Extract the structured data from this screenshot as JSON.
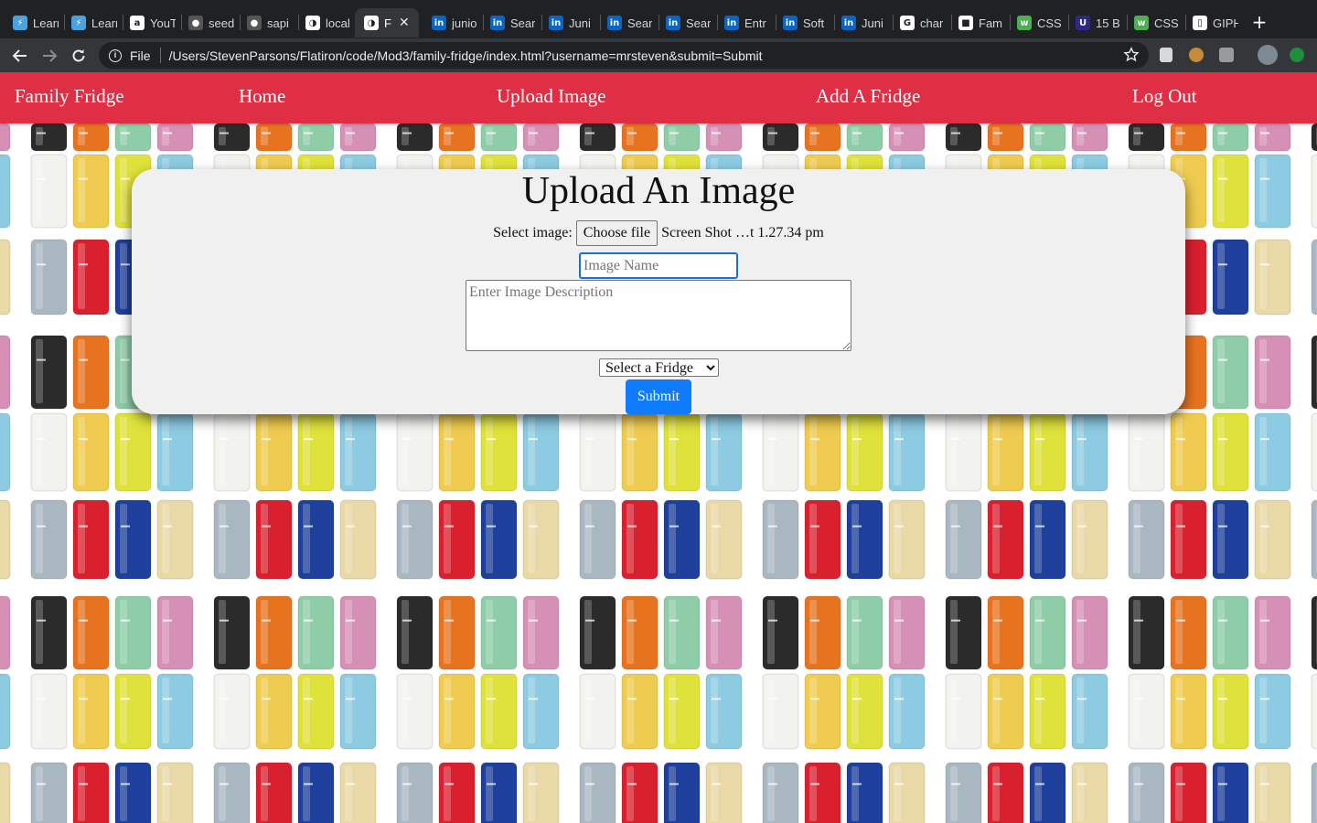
{
  "browser": {
    "tabs": [
      {
        "title": "Learn",
        "icon": "learn-icon",
        "color": "#4aa3df"
      },
      {
        "title": "Learn",
        "icon": "learn-icon",
        "color": "#4aa3df"
      },
      {
        "title": "YouTube",
        "icon": "amazon-icon",
        "color": "#ffffff"
      },
      {
        "title": "seed",
        "icon": "github-icon",
        "color": "#555555"
      },
      {
        "title": "sapi",
        "icon": "github-icon",
        "color": "#555555"
      },
      {
        "title": "local",
        "icon": "globe-icon",
        "color": "#ffffff"
      },
      {
        "title": "F",
        "icon": "globe-icon",
        "color": "#ffffff",
        "active": true
      },
      {
        "title": "junio",
        "icon": "linkedin-icon",
        "color": "#0a66c2"
      },
      {
        "title": "Sear",
        "icon": "linkedin-icon",
        "color": "#0a66c2"
      },
      {
        "title": "Juni",
        "icon": "linkedin-icon",
        "color": "#0a66c2"
      },
      {
        "title": "Sear",
        "icon": "linkedin-icon",
        "color": "#0a66c2"
      },
      {
        "title": "Sear",
        "icon": "linkedin-icon",
        "color": "#0a66c2"
      },
      {
        "title": "Entr",
        "icon": "linkedin-icon",
        "color": "#0a66c2"
      },
      {
        "title": "Soft",
        "icon": "linkedin-icon",
        "color": "#0a66c2"
      },
      {
        "title": "Juni",
        "icon": "linkedin-icon",
        "color": "#0a66c2"
      },
      {
        "title": "char",
        "icon": "google-icon",
        "color": "#ffffff"
      },
      {
        "title": "Fam",
        "icon": "trello-icon",
        "color": "#ffffff"
      },
      {
        "title": "CSS",
        "icon": "w3schools-icon",
        "color": "#4caf50"
      },
      {
        "title": "15 B",
        "icon": "udemy-icon",
        "color": "#2a2a8a"
      },
      {
        "title": "CSS",
        "icon": "w3schools-icon",
        "color": "#4caf50"
      },
      {
        "title": "GIPH",
        "icon": "file-icon",
        "color": "#ffffff"
      }
    ],
    "address": {
      "scheme": "File",
      "url": "/Users/StevenParsons/Flatiron/code/Mod3/family-fridge/index.html?username=mrsteven&submit=Submit"
    }
  },
  "nav": {
    "brand": "Family Fridge",
    "home": "Home",
    "upload": "Upload Image",
    "add_fridge": "Add A Fridge",
    "logout": "Log Out"
  },
  "form": {
    "title": "Upload An Image",
    "select_label": "Select image:",
    "choose_file": "Choose file",
    "file_name": "Screen Shot …t 1.27.34 pm",
    "name_placeholder": "Image Name",
    "description_placeholder": "Enter Image Description",
    "fridge_select": "Select a Fridge",
    "submit": "Submit"
  },
  "colors": {
    "nav_bg": "#e02e45",
    "submit_bg": "#0f7bff",
    "card_bg": "#f0f0f0",
    "fridge_palette": [
      "#2b2b2b",
      "#e8731f",
      "#8fcca8",
      "#d690b5",
      "#f2f2ef",
      "#efcb4f",
      "#dfe23a",
      "#8dcbe2",
      "#a9b7c1",
      "#d9202e",
      "#1e3f9b",
      "#e8d9a6"
    ]
  }
}
